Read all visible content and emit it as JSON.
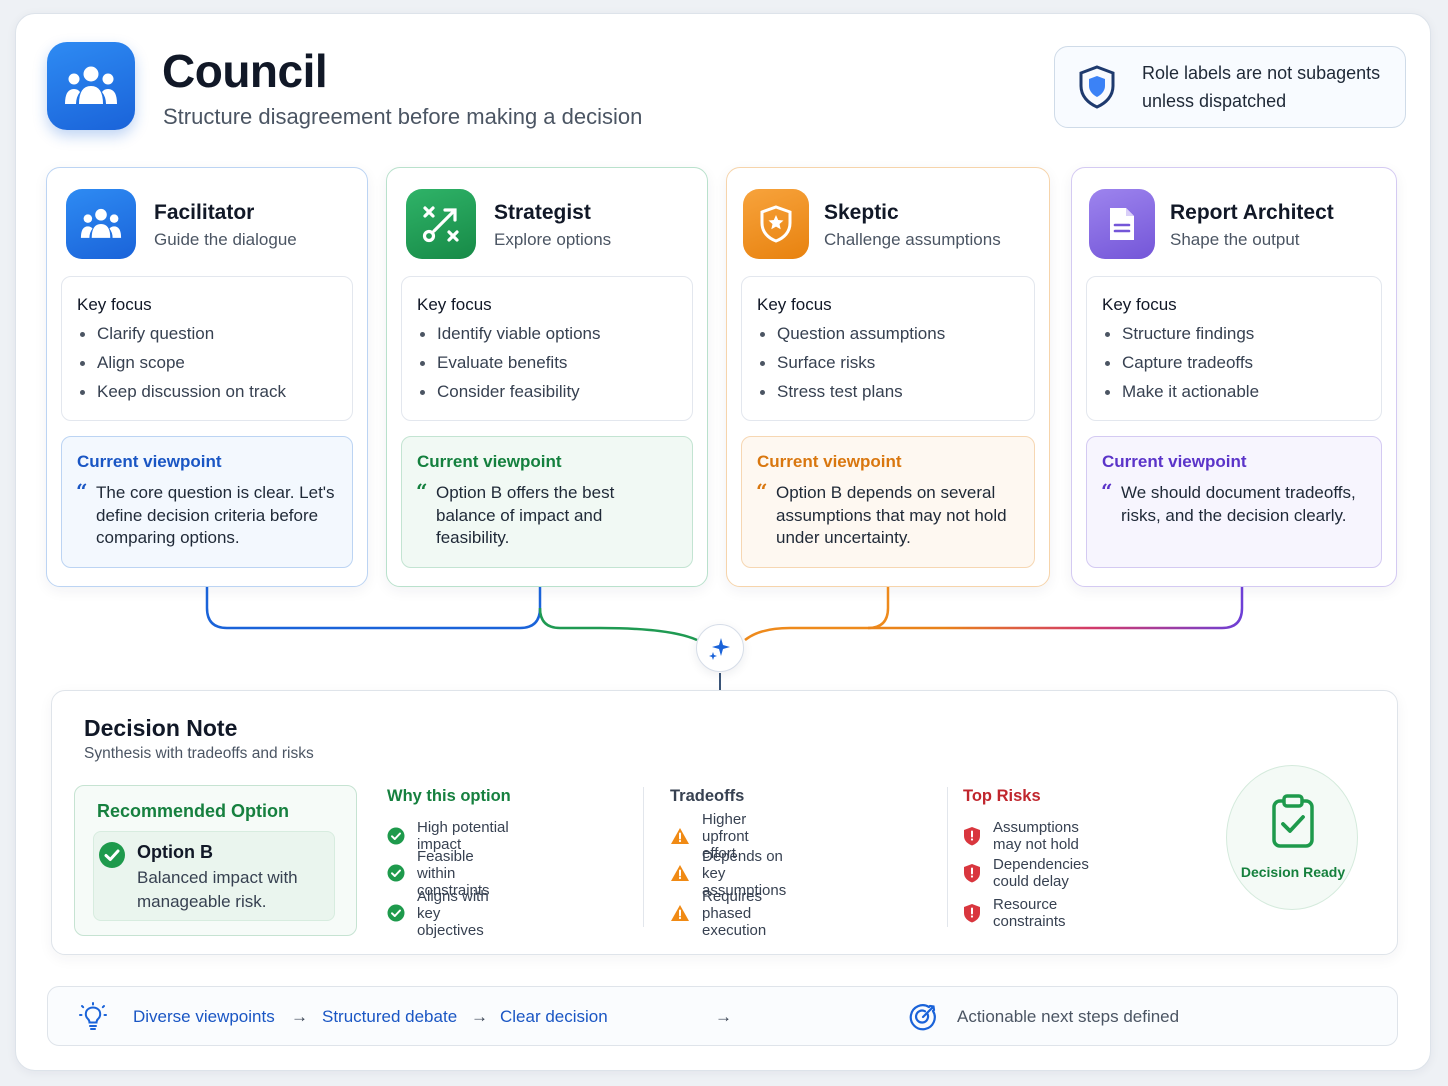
{
  "header": {
    "title": "Council",
    "subtitle": "Structure disagreement before making a decision",
    "notice": "Role labels are not subagents unless dispatched"
  },
  "roles": [
    {
      "name": "Facilitator",
      "tagline": "Guide the dialogue",
      "icon": "people-group-icon",
      "color": "#1a63d9",
      "key_focus_label": "Key focus",
      "focus": [
        "Clarify question",
        "Align scope",
        "Keep discussion on track"
      ],
      "viewpoint_label": "Current viewpoint",
      "viewpoint": "The core question is clear. Let's define decision criteria before comparing options."
    },
    {
      "name": "Strategist",
      "tagline": "Explore options",
      "icon": "strategy-play-icon",
      "color": "#1f9a52",
      "key_focus_label": "Key focus",
      "focus": [
        "Identify viable options",
        "Evaluate benefits",
        "Consider feasibility"
      ],
      "viewpoint_label": "Current viewpoint",
      "viewpoint": "Option B offers the best balance of impact and feasibility."
    },
    {
      "name": "Skeptic",
      "tagline": "Challenge assumptions",
      "icon": "shield-icon",
      "color": "#ee8a1c",
      "key_focus_label": "Key focus",
      "focus": [
        "Question assumptions",
        "Surface risks",
        "Stress test plans"
      ],
      "viewpoint_label": "Current viewpoint",
      "viewpoint": "Option B depends on several assumptions that may not hold under uncertainty."
    },
    {
      "name": "Report Architect",
      "tagline": "Shape the output",
      "icon": "document-icon",
      "color": "#7c5ce0",
      "key_focus_label": "Key focus",
      "focus": [
        "Structure findings",
        "Capture tradeoffs",
        "Make it actionable"
      ],
      "viewpoint_label": "Current viewpoint",
      "viewpoint": "We should document tradeoffs, risks, and the decision clearly."
    }
  ],
  "decision_note": {
    "title": "Decision Note",
    "subtitle": "Synthesis with tradeoffs and risks",
    "recommended_label": "Recommended Option",
    "option_name": "Option B",
    "option_desc": "Balanced impact with manageable risk.",
    "why_label": "Why this option",
    "why": [
      "High potential impact",
      "Feasible within constraints",
      "Aligns with key objectives"
    ],
    "tradeoffs_label": "Tradeoffs",
    "tradeoffs": [
      "Higher upfront effort",
      "Depends on key assumptions",
      "Requires phased execution"
    ],
    "risks_label": "Top Risks",
    "risks": [
      "Assumptions may not hold",
      "Dependencies could delay",
      "Resource constraints"
    ],
    "status": "Decision Ready"
  },
  "footer": {
    "steps": [
      "Diverse viewpoints",
      "Structured debate",
      "Clear decision"
    ],
    "arrow": "→",
    "outcome": "Actionable next steps defined"
  },
  "colors": {
    "blue": "#1a56c4",
    "green": "#16803f",
    "orange": "#d9770f",
    "purple": "#5b34c9",
    "red": "#c0262d"
  }
}
